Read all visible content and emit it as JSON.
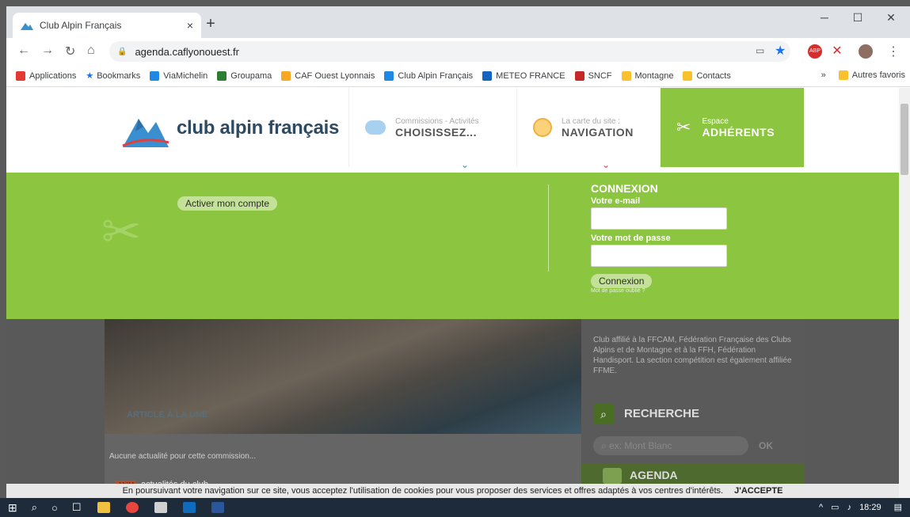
{
  "browser": {
    "tab_title": "Club Alpin Français",
    "new_tab": "+",
    "tab_close": "×",
    "url": "agenda.caflyonouest.fr",
    "window_controls": {
      "minimize": "─",
      "maximize": "☐",
      "close": "✕"
    }
  },
  "bookmarks": {
    "items": [
      {
        "label": "Applications",
        "color": "#e53935"
      },
      {
        "label": "Bookmarks",
        "color": "#1a73e8"
      },
      {
        "label": "ViaMichelin",
        "color": "#1e88e5"
      },
      {
        "label": "Groupama",
        "color": "#2e7d32"
      },
      {
        "label": "CAF Ouest Lyonnais",
        "color": "#f9a825"
      },
      {
        "label": "Club Alpin Français",
        "color": "#1e88e5"
      },
      {
        "label": "METEO FRANCE",
        "color": "#1565c0"
      },
      {
        "label": "SNCF",
        "color": "#c62828"
      },
      {
        "label": "Montagne",
        "color": "#fbc02d"
      },
      {
        "label": "Contacts",
        "color": "#fbc02d"
      }
    ],
    "more": "»",
    "other": "Autres favoris"
  },
  "header": {
    "logo_text": "club alpin français",
    "menu": [
      {
        "small": "Commissions - Activités",
        "big": "CHOISISSEZ..."
      },
      {
        "small": "La carte du site :",
        "big": "NAVIGATION"
      },
      {
        "small": "Espace",
        "big": "ADHÉRENTS"
      }
    ]
  },
  "account": {
    "activate": "Activer mon compte",
    "login_title": "CONNEXION",
    "email_label": "Votre e-mail",
    "password_label": "Votre mot de passe",
    "submit": "Connexion",
    "forgot": "Mot de passe oublié ?"
  },
  "main": {
    "hero_caption": "ARTICLE À LA UNE",
    "no_news": "Aucune actualité pour cette commission...",
    "news_tag": "ANIM",
    "news_item": "actualités du club"
  },
  "sidebar": {
    "about": "Club affilié à la FFCAM, Fédération Française des Clubs Alpins et de Montagne et à la FFH, Fédération Handisport. La section compétition est également affiliée FFME.",
    "search_title": "RECHERCHE",
    "search_placeholder": "ex: Mont Blanc",
    "search_ok": "OK",
    "agenda_title": "AGENDA"
  },
  "cookie": {
    "text": "En poursuivant votre navigation sur ce site, vous acceptez l'utilisation de cookies pour vous proposer des services et offres adaptés à vos centres d'intérêts.",
    "accept": "J'ACCEPTE"
  },
  "taskbar": {
    "time": "18:29"
  },
  "colors": {
    "accent_green": "#8cc540",
    "taskbar": "#1d2b3a"
  }
}
